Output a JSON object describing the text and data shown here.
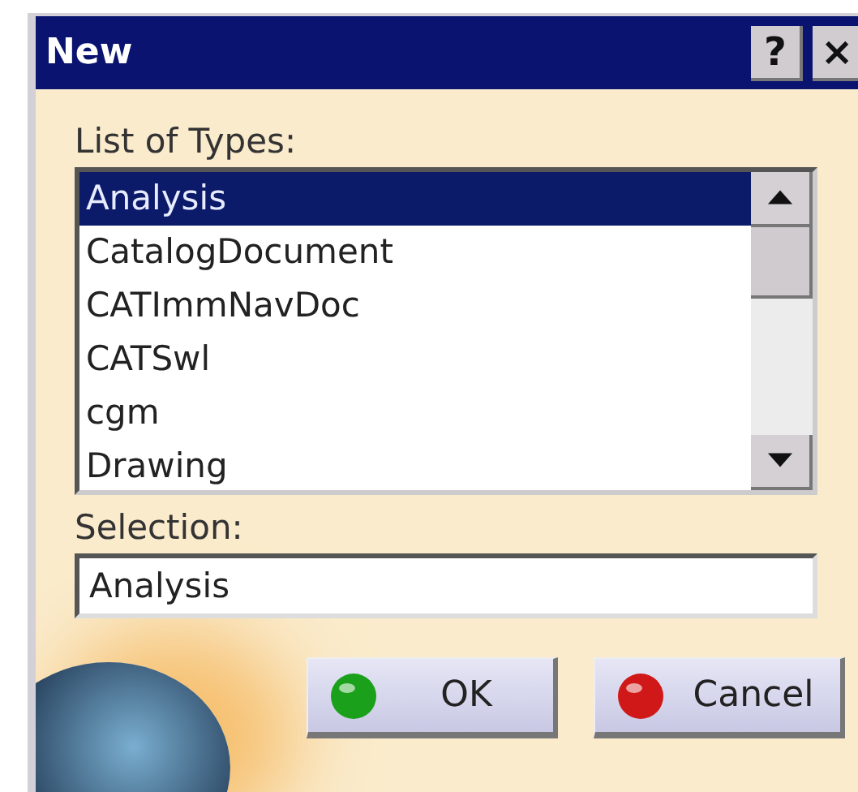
{
  "window": {
    "title": "New",
    "help_button": "?",
    "close_button": "×"
  },
  "list_label": "List of Types:",
  "types": [
    {
      "label": "Analysis",
      "selected": true
    },
    {
      "label": "CatalogDocument",
      "selected": false
    },
    {
      "label": "CATImmNavDoc",
      "selected": false
    },
    {
      "label": "CATSwl",
      "selected": false
    },
    {
      "label": "cgm",
      "selected": false
    },
    {
      "label": "Drawing",
      "selected": false
    }
  ],
  "selection_label": "Selection:",
  "selection": {
    "value": "Analysis"
  },
  "buttons": [
    {
      "kind": "ok",
      "label": "OK"
    },
    {
      "kind": "cancel",
      "label": "Cancel"
    }
  ]
}
